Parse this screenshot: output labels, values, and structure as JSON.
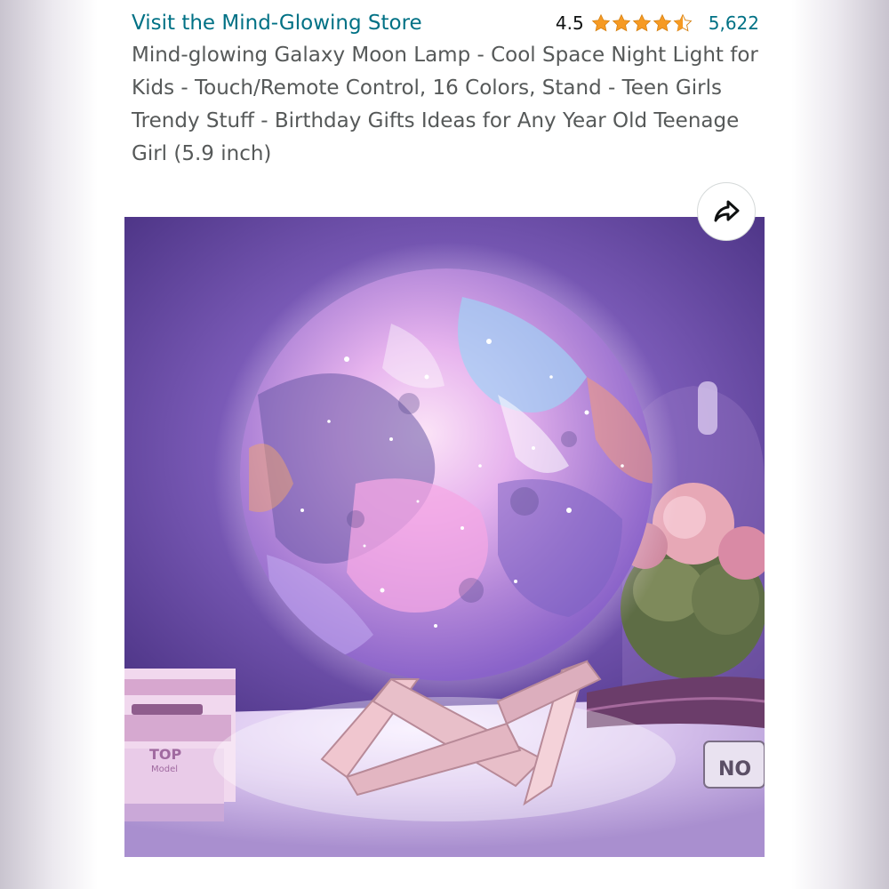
{
  "store": {
    "link_label": "Visit the Mind-Glowing Store"
  },
  "rating": {
    "value": "4.5",
    "stars": 4.5,
    "review_count": "5,622",
    "star_color": "#f69a23"
  },
  "product": {
    "title": "Mind-glowing Galaxy Moon Lamp - Cool Space Night Light for Kids - Touch/Remote Control, 16 Colors, Stand - Teen Girls Trendy Stuff - Birthday Gifts Ideas for Any Year Old Teenage Girl (5.9 inch)"
  },
  "share": {
    "icon": "share-arrow-icon"
  },
  "image": {
    "book_lettering": "TOP Model",
    "bracelet_lettering": "NO",
    "palette": {
      "wall": "#7b5bb8",
      "table": "#d9c4ee",
      "moon_pink": "#f4a7e4",
      "moon_blue": "#9fd1f5",
      "moon_purple": "#8a63c9",
      "stand_wood": "#e8bfc9"
    }
  },
  "colors": {
    "link": "#007185",
    "title_text": "#565959",
    "rating_text": "#0f1111"
  }
}
